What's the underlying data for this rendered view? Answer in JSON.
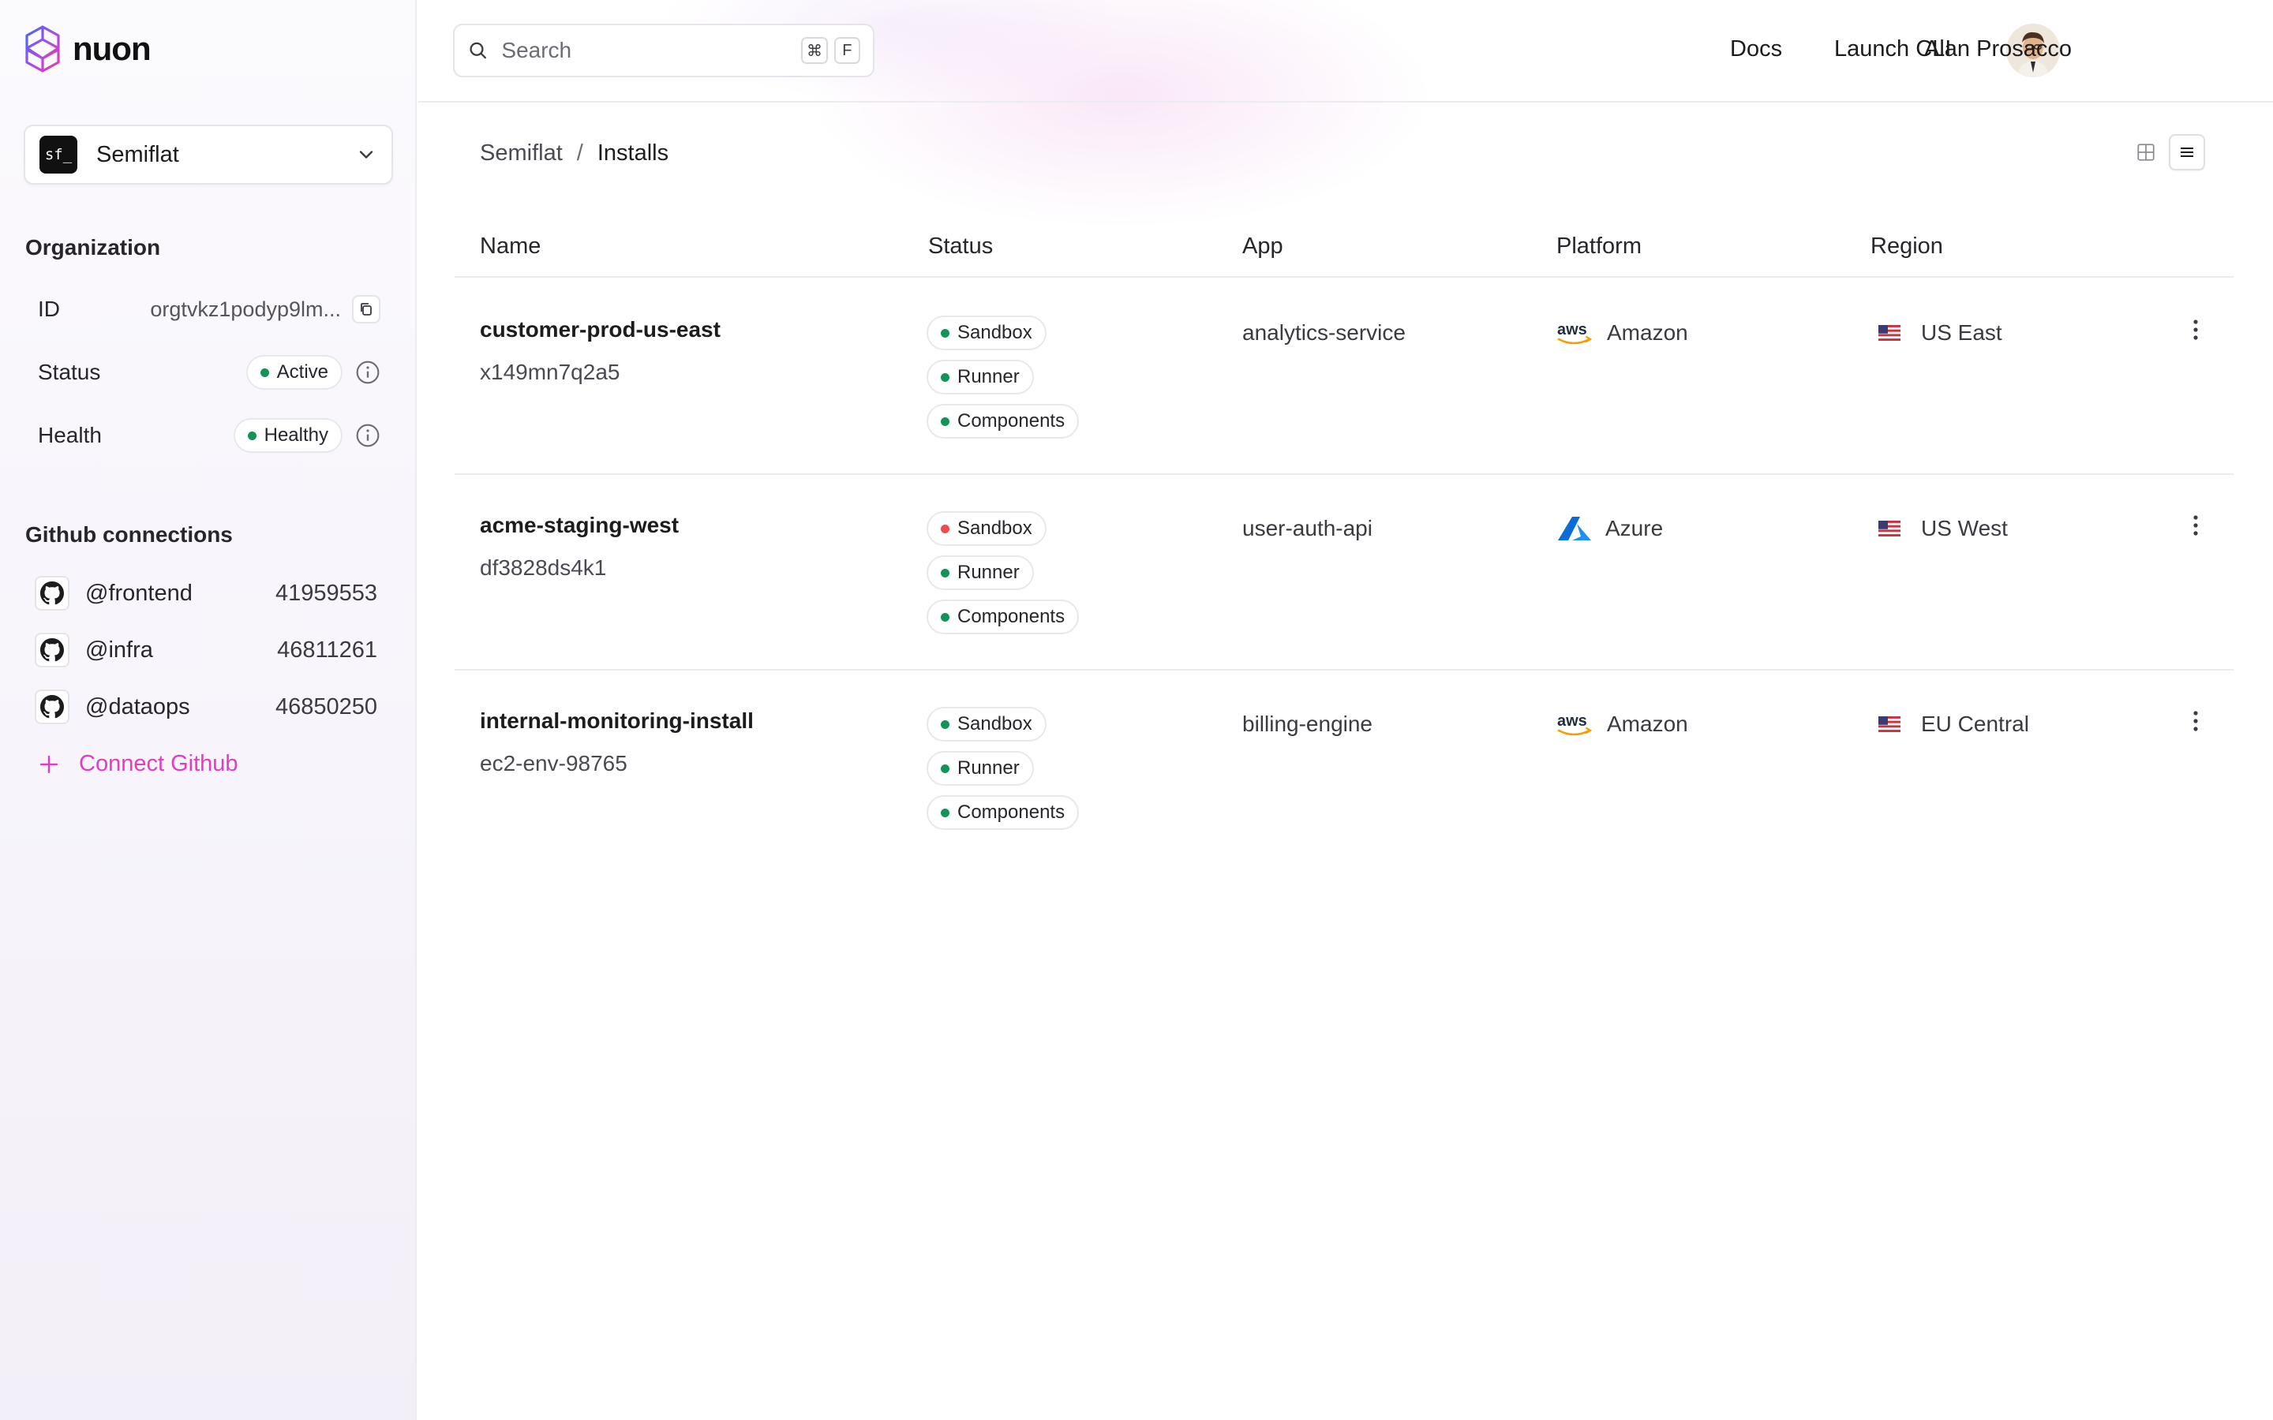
{
  "app": {
    "logo_text": "nuon"
  },
  "org_switcher": {
    "avatar_text": "sf_",
    "name": "Semiflat"
  },
  "organization": {
    "title": "Organization",
    "id_label": "ID",
    "id_value": "orgtvkz1podyp9lm...",
    "status_label": "Status",
    "status_value": "Active",
    "health_label": "Health",
    "health_value": "Healthy"
  },
  "github": {
    "title": "Github connections",
    "connections": [
      {
        "name": "@frontend",
        "id": "41959553"
      },
      {
        "name": "@infra",
        "id": "46811261"
      },
      {
        "name": "@dataops",
        "id": "46850250"
      }
    ],
    "connect_label": "Connect Github"
  },
  "header": {
    "search_placeholder": "Search",
    "shortcut_keys": [
      "⌘",
      "F"
    ],
    "docs_label": "Docs",
    "launch_cli_label": "Launch CLI",
    "user_name": "Alan Prosacco"
  },
  "breadcrumb": {
    "org": "Semiflat",
    "separator": "/",
    "page": "Installs"
  },
  "view_toggle": {
    "active": "list"
  },
  "table": {
    "columns": {
      "name": "Name",
      "status": "Status",
      "app": "App",
      "platform": "Platform",
      "region": "Region"
    },
    "rows": [
      {
        "name": "customer-prod-us-east",
        "id": "x149mn7q2a5",
        "statuses": [
          {
            "label": "Sandbox",
            "color": "#12935a"
          },
          {
            "label": "Runner",
            "color": "#12935a"
          },
          {
            "label": "Components",
            "color": "#12935a"
          }
        ],
        "app": "analytics-service",
        "platform": "Amazon",
        "platform_icon": "aws-icon",
        "region": "US East",
        "region_icon": "us-flag-icon"
      },
      {
        "name": "acme-staging-west",
        "id": "df3828ds4k1",
        "statuses": [
          {
            "label": "Sandbox",
            "color": "#ef4b4b"
          },
          {
            "label": "Runner",
            "color": "#12935a"
          },
          {
            "label": "Components",
            "color": "#12935a"
          }
        ],
        "app": "user-auth-api",
        "platform": "Azure",
        "platform_icon": "azure-icon",
        "region": "US West",
        "region_icon": "us-flag-icon"
      },
      {
        "name": "internal-monitoring-install",
        "id": "ec2-env-98765",
        "statuses": [
          {
            "label": "Sandbox",
            "color": "#12935a"
          },
          {
            "label": "Runner",
            "color": "#12935a"
          },
          {
            "label": "Components",
            "color": "#12935a"
          }
        ],
        "app": "billing-engine",
        "platform": "Amazon",
        "platform_icon": "aws-icon",
        "region": "EU Central",
        "region_icon": "us-flag-icon"
      }
    ]
  },
  "colors": {
    "accent": "#e33bc3",
    "status_ok": "#12935a",
    "status_error": "#ef4b4b"
  }
}
